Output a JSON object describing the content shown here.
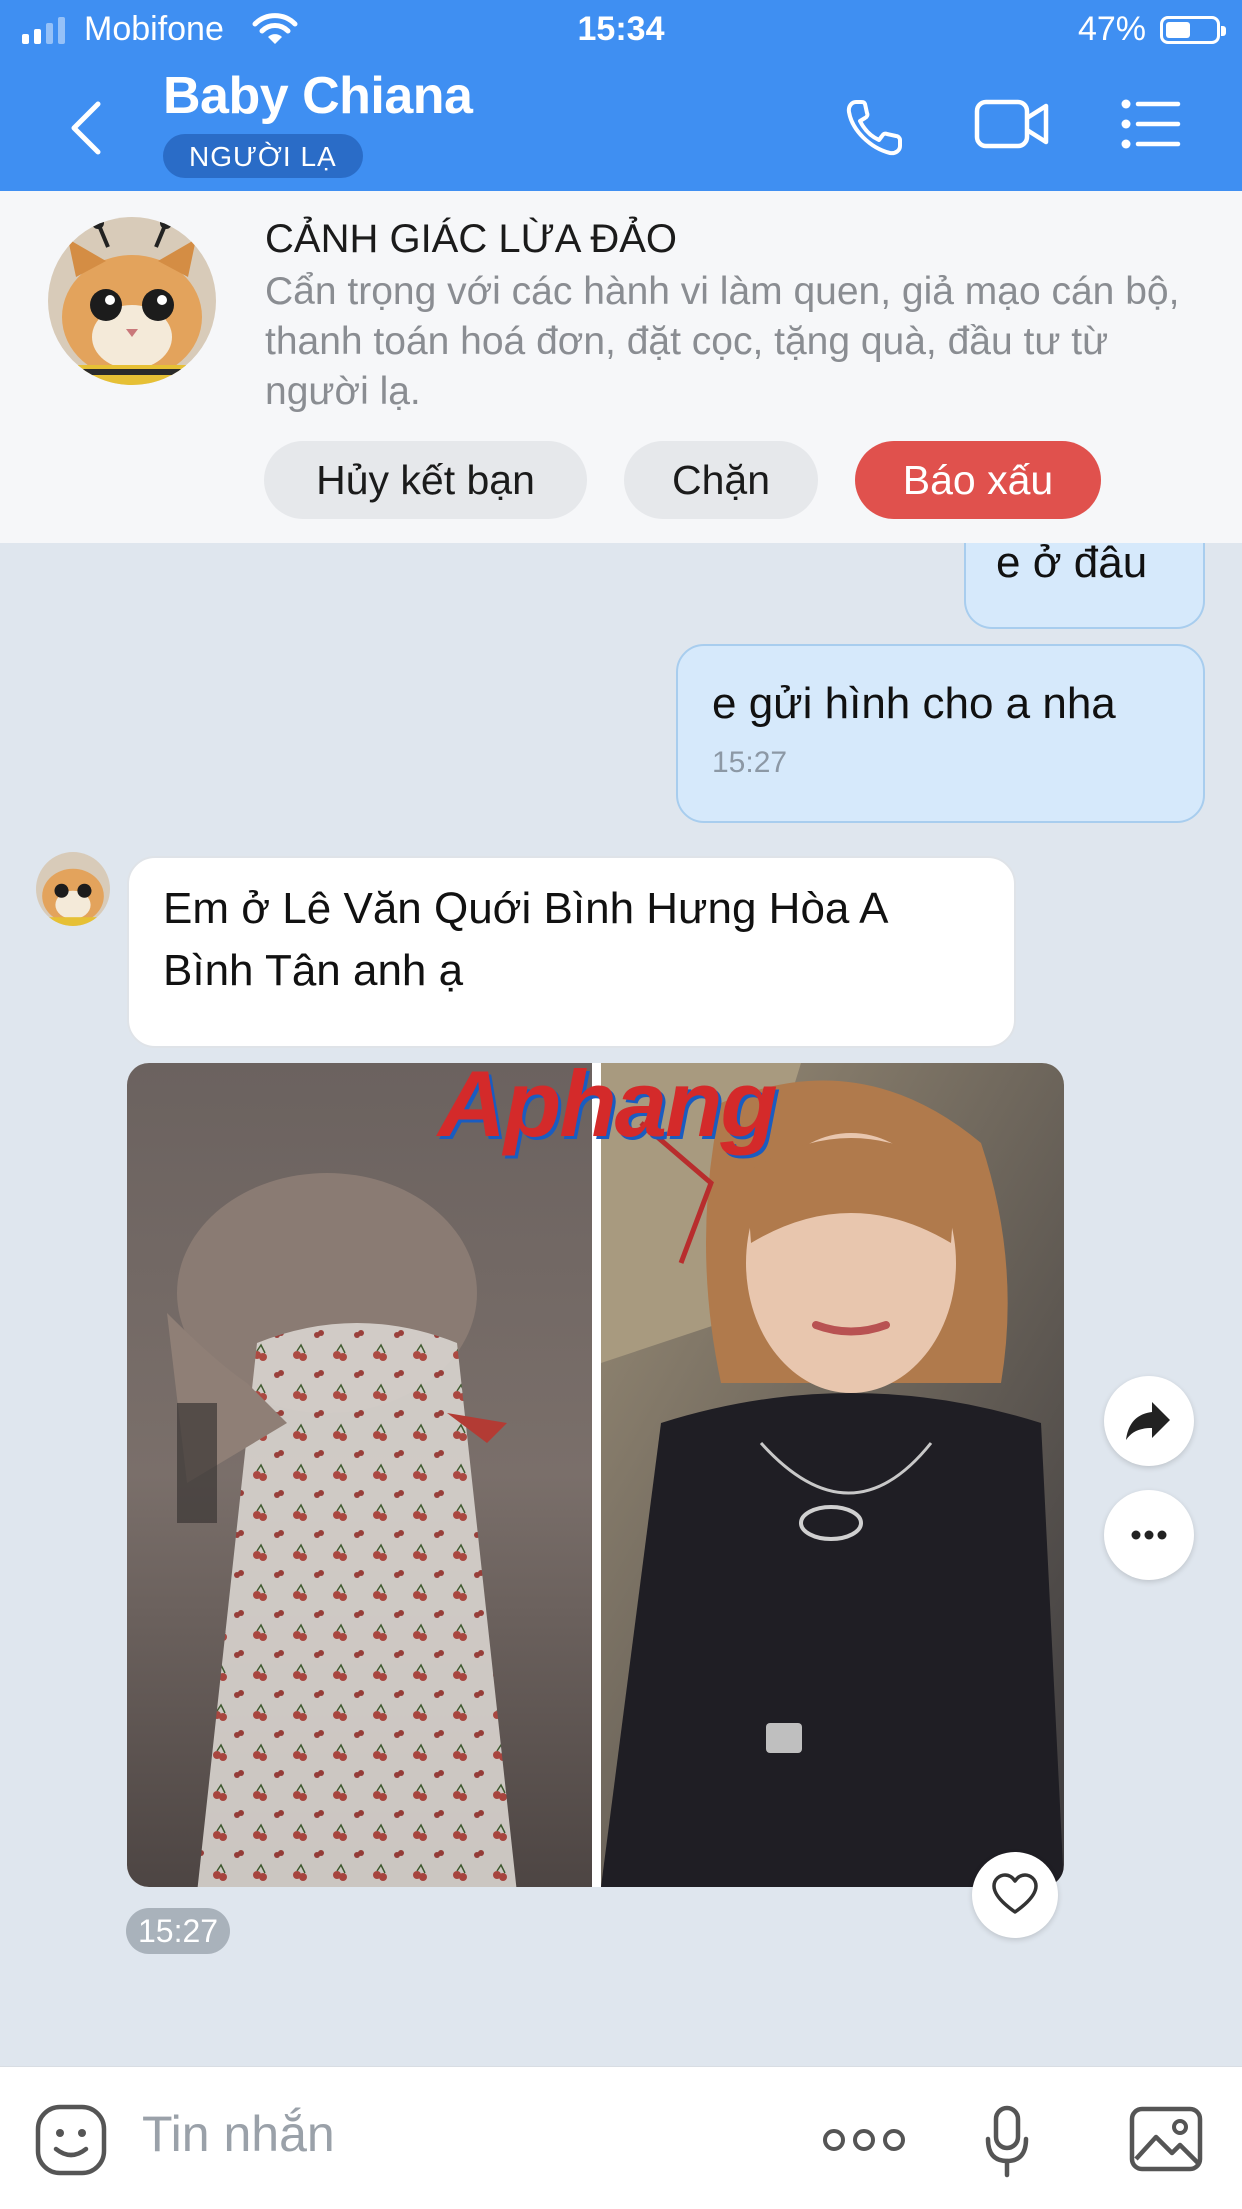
{
  "status_bar": {
    "carrier": "Mobifone",
    "time": "15:34",
    "battery": "47%",
    "battery_level": 0.47
  },
  "header": {
    "title": "Baby Chiana",
    "badge": "NGƯỜI LẠ",
    "icons": [
      "back-chevron-icon",
      "phone-icon",
      "video-call-icon",
      "menu-list-icon"
    ]
  },
  "warning": {
    "title": "CẢNH GIÁC LỪA ĐẢO",
    "body": "Cẩn trọng với các hành vi làm quen, giả mạo cán bộ, thanh toán hoá đơn, đặt cọc, tặng quà, đầu tư từ người lạ.",
    "buttons": {
      "unfriend": "Hủy kết bạn",
      "block": "Chặn",
      "report": "Báo xấu"
    },
    "colors": {
      "report": "#e0514d"
    }
  },
  "messages": {
    "out1": {
      "text": "e ở đâu"
    },
    "out2": {
      "text": "e gửi hình cho a nha",
      "time": "15:27"
    },
    "in1": {
      "text": "Em ở Lê Văn Quới Bình Hưng Hòa A Bình Tân anh ạ"
    },
    "photo": {
      "time": "15:27",
      "watermark": "Aphang"
    }
  },
  "input": {
    "placeholder": "Tin nhắn"
  },
  "colors": {
    "header": "#3f8ff2",
    "chat_bg": "#dfe6ee",
    "out_bubble": "#d6e9fb"
  }
}
